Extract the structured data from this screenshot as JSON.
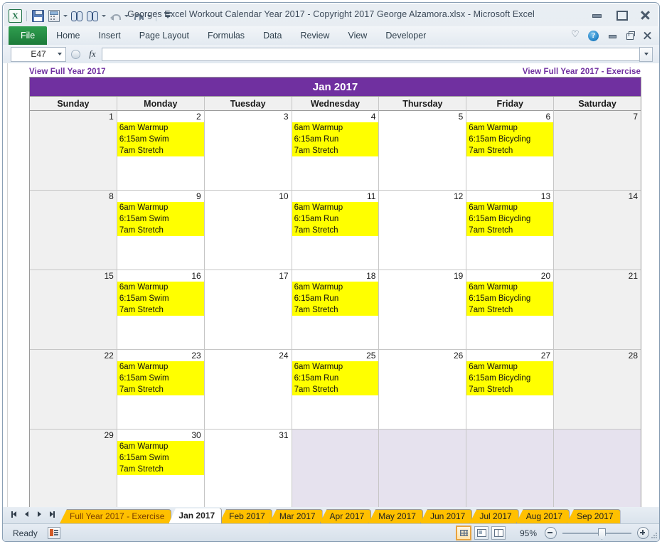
{
  "window": {
    "title": "Georges Excel Workout Calendar Year 2017  -  Copyright 2017 George Alzamora.xlsx  -  Microsoft Excel",
    "minimize_label": "Minimize",
    "maximize_label": "Maximize",
    "close_label": "Close"
  },
  "quick_access": {
    "excel_logo": "X",
    "items": [
      {
        "name": "save",
        "label": "Save"
      },
      {
        "name": "calculate",
        "label": "Calculate"
      },
      {
        "name": "find",
        "label": "Find"
      },
      {
        "name": "find-options",
        "label": "Find Options"
      },
      {
        "name": "undo",
        "label": "Undo"
      },
      {
        "name": "redo",
        "label": "Redo"
      },
      {
        "name": "customize",
        "label": "Customize Quick Access Toolbar"
      }
    ]
  },
  "ribbon": {
    "tabs": [
      {
        "label": "File",
        "active": true
      },
      {
        "label": "Home",
        "active": false
      },
      {
        "label": "Insert",
        "active": false
      },
      {
        "label": "Page Layout",
        "active": false
      },
      {
        "label": "Formulas",
        "active": false
      },
      {
        "label": "Data",
        "active": false
      },
      {
        "label": "Review",
        "active": false
      },
      {
        "label": "View",
        "active": false
      },
      {
        "label": "Developer",
        "active": false
      }
    ],
    "help_label": "?",
    "collapse_label": "Minimize the Ribbon"
  },
  "formula_bar": {
    "name_box_value": "E47",
    "fx_label": "fx",
    "formula_value": "",
    "formula_placeholder": ""
  },
  "sheet": {
    "link_left": "View Full Year 2017",
    "link_right": "View Full Year 2017 - Exercise",
    "calendar_title": "Jan 2017",
    "day_headers": [
      "Sunday",
      "Monday",
      "Tuesday",
      "Wednesday",
      "Thursday",
      "Friday",
      "Saturday"
    ],
    "accent_color": "#7030A0",
    "event_highlight_color": "#FFFF00",
    "weekend_color": "#F0F0F0",
    "blank_color": "#E6E2EE",
    "weeks": [
      [
        {
          "num": "1",
          "weekend": true,
          "events": []
        },
        {
          "num": "2",
          "weekend": false,
          "events": [
            "6am Warmup",
            "6:15am Swim",
            "7am Stretch"
          ]
        },
        {
          "num": "3",
          "weekend": false,
          "events": []
        },
        {
          "num": "4",
          "weekend": false,
          "events": [
            "6am Warmup",
            "6:15am Run",
            "7am Stretch"
          ]
        },
        {
          "num": "5",
          "weekend": false,
          "events": []
        },
        {
          "num": "6",
          "weekend": false,
          "events": [
            "6am Warmup",
            "6:15am Bicycling",
            "7am Stretch"
          ]
        },
        {
          "num": "7",
          "weekend": true,
          "events": []
        }
      ],
      [
        {
          "num": "8",
          "weekend": true,
          "events": []
        },
        {
          "num": "9",
          "weekend": false,
          "events": [
            "6am Warmup",
            "6:15am Swim",
            "7am Stretch"
          ]
        },
        {
          "num": "10",
          "weekend": false,
          "events": []
        },
        {
          "num": "11",
          "weekend": false,
          "events": [
            "6am Warmup",
            "6:15am Run",
            "7am Stretch"
          ]
        },
        {
          "num": "12",
          "weekend": false,
          "events": []
        },
        {
          "num": "13",
          "weekend": false,
          "events": [
            "6am Warmup",
            "6:15am Bicycling",
            "7am Stretch"
          ]
        },
        {
          "num": "14",
          "weekend": true,
          "events": []
        }
      ],
      [
        {
          "num": "15",
          "weekend": true,
          "events": []
        },
        {
          "num": "16",
          "weekend": false,
          "events": [
            "6am Warmup",
            "6:15am Swim",
            "7am Stretch"
          ]
        },
        {
          "num": "17",
          "weekend": false,
          "events": []
        },
        {
          "num": "18",
          "weekend": false,
          "events": [
            "6am Warmup",
            "6:15am Run",
            "7am Stretch"
          ]
        },
        {
          "num": "19",
          "weekend": false,
          "events": []
        },
        {
          "num": "20",
          "weekend": false,
          "events": [
            "6am Warmup",
            "6:15am Bicycling",
            "7am Stretch"
          ]
        },
        {
          "num": "21",
          "weekend": true,
          "events": []
        }
      ],
      [
        {
          "num": "22",
          "weekend": true,
          "events": []
        },
        {
          "num": "23",
          "weekend": false,
          "events": [
            "6am Warmup",
            "6:15am Swim",
            "7am Stretch"
          ]
        },
        {
          "num": "24",
          "weekend": false,
          "events": []
        },
        {
          "num": "25",
          "weekend": false,
          "events": [
            "6am Warmup",
            "6:15am Run",
            "7am Stretch"
          ]
        },
        {
          "num": "26",
          "weekend": false,
          "events": []
        },
        {
          "num": "27",
          "weekend": false,
          "events": [
            "6am Warmup",
            "6:15am Bicycling",
            "7am Stretch"
          ]
        },
        {
          "num": "28",
          "weekend": true,
          "events": []
        }
      ],
      [
        {
          "num": "29",
          "weekend": true,
          "events": []
        },
        {
          "num": "30",
          "weekend": false,
          "events": [
            "6am Warmup",
            "6:15am Swim",
            "7am Stretch"
          ]
        },
        {
          "num": "31",
          "weekend": false,
          "events": []
        },
        {
          "num": "",
          "blank": true,
          "events": []
        },
        {
          "num": "",
          "blank": true,
          "events": []
        },
        {
          "num": "",
          "blank": true,
          "events": []
        },
        {
          "num": "",
          "blank": true,
          "events": []
        }
      ]
    ]
  },
  "sheet_tabs": {
    "nav": [
      "first-sheet",
      "previous-sheet",
      "next-sheet",
      "last-sheet"
    ],
    "items": [
      {
        "label": "Full Year 2017 - Exercise",
        "active": false,
        "highlight": true
      },
      {
        "label": "Jan 2017",
        "active": true,
        "highlight": false
      },
      {
        "label": "Feb 2017",
        "active": false,
        "highlight": false
      },
      {
        "label": "Mar 2017",
        "active": false,
        "highlight": false
      },
      {
        "label": "Apr 2017",
        "active": false,
        "highlight": false
      },
      {
        "label": "May 2017",
        "active": false,
        "highlight": false
      },
      {
        "label": "Jun 2017",
        "active": false,
        "highlight": false
      },
      {
        "label": "Jul 2017",
        "active": false,
        "highlight": false
      },
      {
        "label": "Aug 2017",
        "active": false,
        "highlight": false
      },
      {
        "label": "Sep 2017",
        "active": false,
        "highlight": false
      }
    ]
  },
  "status_bar": {
    "status": "Ready",
    "macro_label": "Record Macro",
    "views": [
      {
        "name": "normal-view",
        "label": "Normal",
        "active": true
      },
      {
        "name": "page-layout-view",
        "label": "Page Layout",
        "active": false
      },
      {
        "name": "page-break-preview",
        "label": "Page Break Preview",
        "active": false
      }
    ],
    "zoom": "95%",
    "zoom_out_label": "Zoom Out",
    "zoom_in_label": "Zoom In"
  }
}
